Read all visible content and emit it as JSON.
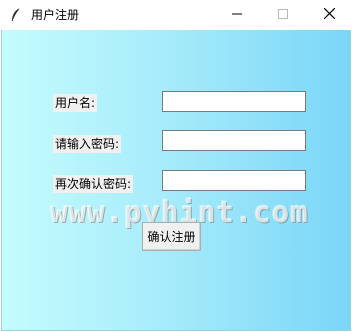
{
  "window": {
    "title": "用户注册",
    "icon": "feather-icon",
    "controls": [
      "minimize-icon",
      "maximize-icon",
      "close-icon"
    ]
  },
  "form": {
    "username_label": "用户名:",
    "username_value": "",
    "password_label": "请输入密码:",
    "password_value": "",
    "confirm_label": "再次确认密码:",
    "confirm_value": "",
    "submit_label": "确认注册"
  },
  "watermark": "www.pyhint.com",
  "colors": {
    "background_left": "#c4fcfd",
    "background_right": "#7ad6f7"
  }
}
